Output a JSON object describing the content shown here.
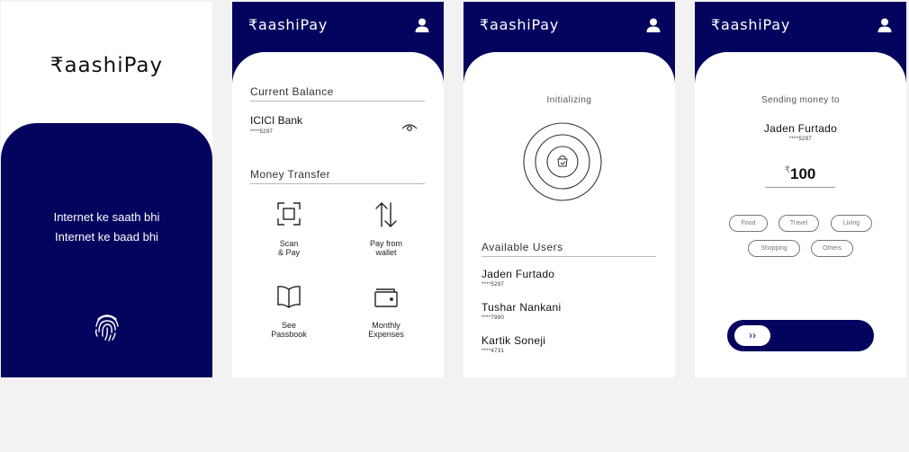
{
  "brand": "₹aashiPay",
  "splash": {
    "tagline_line1": "Internet ke saath bhi",
    "tagline_line2": "Internet ke baad bhi",
    "icons": [
      "fingerprint-icon"
    ]
  },
  "home": {
    "balance_title": "Current Balance",
    "bank_name": "ICICI Bank",
    "bank_account": "****5297",
    "transfer_title": "Money Transfer",
    "actions": [
      {
        "label": "Scan\n& Pay",
        "icon": "scan-icon"
      },
      {
        "label": "Pay from\nwallet",
        "icon": "transfer-arrows-icon"
      },
      {
        "label": "See\nPassbook",
        "icon": "book-icon"
      },
      {
        "label": "Monthly\nExpenses",
        "icon": "wallet-icon"
      }
    ]
  },
  "discover": {
    "status": "Initializing",
    "users_title": "Available Users",
    "users": [
      {
        "name": "Jaden Furtado",
        "account": "****5297"
      },
      {
        "name": "Tushar Nankani",
        "account": "****7980"
      },
      {
        "name": "Kartik Soneji",
        "account": "****4731"
      }
    ]
  },
  "send": {
    "label": "Sending money to",
    "recipient": "Jaden Furtado",
    "recipient_account": "****5297",
    "currency": "₹",
    "amount": "100",
    "categories": [
      "Food",
      "Travel",
      "Living",
      "Shopping",
      "Others"
    ],
    "slider_symbol": "››"
  },
  "colors": {
    "brand_navy": "#04045e",
    "page_bg": "#f2f2f2"
  }
}
